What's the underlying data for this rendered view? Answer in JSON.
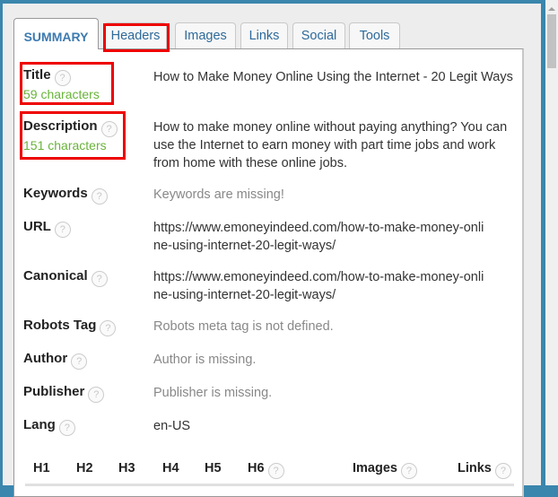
{
  "tabs": [
    {
      "label": "SUMMARY",
      "active": true
    },
    {
      "label": "Headers",
      "active": false,
      "highlighted": true
    },
    {
      "label": "Images",
      "active": false
    },
    {
      "label": "Links",
      "active": false
    },
    {
      "label": "Social",
      "active": false
    },
    {
      "label": "Tools",
      "active": false
    }
  ],
  "help_glyph": "?",
  "summary": {
    "title": {
      "label": "Title",
      "count": "59 characters",
      "value": "How to Make Money Online Using the Internet - 20 Legit Ways"
    },
    "description": {
      "label": "Description",
      "count": "151 characters",
      "value": "How to make money online without paying anything? You can use the Internet to earn money with part time jobs and work from home with these online jobs."
    },
    "keywords": {
      "label": "Keywords",
      "value": "Keywords are missing!"
    },
    "url": {
      "label": "URL",
      "value": "https://www.emoneyindeed.com/how-to-make-money-online-using-internet-20-legit-ways/"
    },
    "canonical": {
      "label": "Canonical",
      "value": "https://www.emoneyindeed.com/how-to-make-money-online-using-internet-20-legit-ways/"
    },
    "robots": {
      "label": "Robots Tag",
      "value": "Robots meta tag is not defined."
    },
    "author": {
      "label": "Author",
      "value": "Author is missing."
    },
    "publisher": {
      "label": "Publisher",
      "value": "Publisher is missing."
    },
    "lang": {
      "label": "Lang",
      "value": "en-US"
    }
  },
  "stats_headers": [
    "H1",
    "H2",
    "H3",
    "H4",
    "H5",
    "H6",
    "Images",
    "Links"
  ],
  "colors": {
    "accent_blue": "#3a86ad",
    "count_green": "#69b33a",
    "highlight_red": "#e00000"
  }
}
